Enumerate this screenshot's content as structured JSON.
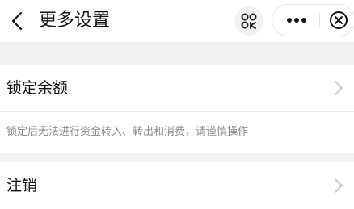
{
  "header": {
    "title": "更多设置",
    "back_icon": "chevron-left-icon",
    "scan_icon": "scan-icon",
    "more_icon": "more-dots-icon",
    "close_icon": "close-circle-icon"
  },
  "settings": {
    "items": [
      {
        "label": "锁定余额",
        "icon": "chevron-right-icon"
      },
      {
        "label": "注销",
        "icon": "chevron-right-icon"
      }
    ],
    "lock_note": "锁定后无法进行资金转入、转出和消费，请谨慎操作"
  },
  "colors": {
    "background": "#ffffff",
    "section_gap": "#f2f2f2",
    "primary_text": "#111111",
    "secondary_text": "#8a8a8a",
    "chevron": "#c4c4c4"
  }
}
